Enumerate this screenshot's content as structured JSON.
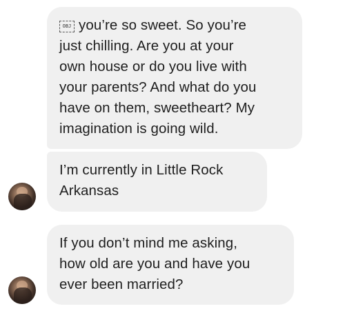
{
  "messages": [
    {
      "id": "m1",
      "has_object_icon": true,
      "object_icon_text": "OBJ",
      "lines": [
        "you’re so sweet. So you’re",
        "just chilling. Are you at your",
        "own house or do you live with",
        "your parents? And what do you",
        "have on them, sweetheart? My",
        "imagination is going wild."
      ]
    },
    {
      "id": "m2",
      "lines": [
        "I’m currently in Little Rock",
        "Arkansas"
      ]
    },
    {
      "id": "m3",
      "lines": [
        "If you don’t mind me asking,",
        "how old are you and have you",
        "ever been married?"
      ]
    }
  ],
  "colors": {
    "bubble_background": "#f0f0f0",
    "text": "#1e1e1e",
    "page_background": "#ffffff"
  },
  "icons": {
    "object_placeholder": "obj-placeholder-icon",
    "avatar": "sender-avatar"
  }
}
